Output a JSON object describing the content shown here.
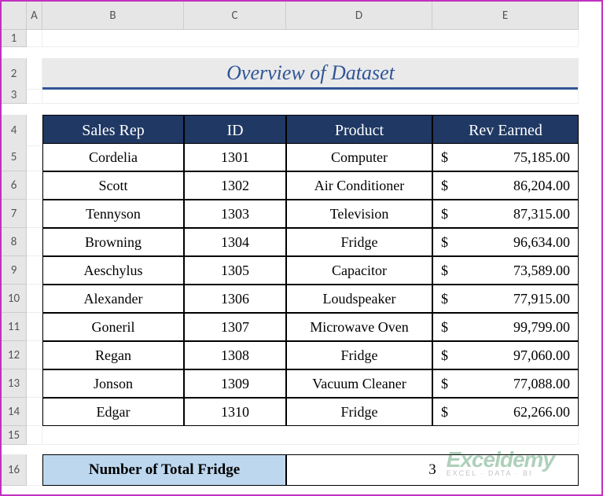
{
  "columns": [
    "",
    "A",
    "B",
    "C",
    "D",
    "E"
  ],
  "row_numbers": [
    "1",
    "2",
    "3",
    "4",
    "5",
    "6",
    "7",
    "8",
    "9",
    "10",
    "11",
    "12",
    "13",
    "14",
    "15",
    "16"
  ],
  "title": "Overview of Dataset",
  "headers": [
    "Sales Rep",
    "ID",
    "Product",
    "Rev Earned"
  ],
  "rows": [
    {
      "rep": "Cordelia",
      "id": "1301",
      "product": "Computer",
      "sym": "$",
      "rev": "75,185.00"
    },
    {
      "rep": "Scott",
      "id": "1302",
      "product": "Air Conditioner",
      "sym": "$",
      "rev": "86,204.00"
    },
    {
      "rep": "Tennyson",
      "id": "1303",
      "product": "Television",
      "sym": "$",
      "rev": "87,315.00"
    },
    {
      "rep": "Browning",
      "id": "1304",
      "product": "Fridge",
      "sym": "$",
      "rev": "96,634.00"
    },
    {
      "rep": "Aeschylus",
      "id": "1305",
      "product": "Capacitor",
      "sym": "$",
      "rev": "73,589.00"
    },
    {
      "rep": "Alexander",
      "id": "1306",
      "product": "Loudspeaker",
      "sym": "$",
      "rev": "77,915.00"
    },
    {
      "rep": "Goneril",
      "id": "1307",
      "product": "Microwave Oven",
      "sym": "$",
      "rev": "99,799.00"
    },
    {
      "rep": "Regan",
      "id": "1308",
      "product": "Fridge",
      "sym": "$",
      "rev": "97,060.00"
    },
    {
      "rep": "Jonson",
      "id": "1309",
      "product": "Vacuum Cleaner",
      "sym": "$",
      "rev": "77,088.00"
    },
    {
      "rep": "Edgar",
      "id": "1310",
      "product": "Fridge",
      "sym": "$",
      "rev": "62,266.00"
    }
  ],
  "summary": {
    "label": "Number of Total Fridge",
    "value": "3"
  },
  "watermark": {
    "main": "Exceldemy",
    "sub": "EXCEL · DATA · BI"
  },
  "chart_data": {
    "type": "table",
    "title": "Overview of Dataset",
    "columns": [
      "Sales Rep",
      "ID",
      "Product",
      "Rev Earned"
    ],
    "data": [
      [
        "Cordelia",
        1301,
        "Computer",
        75185.0
      ],
      [
        "Scott",
        1302,
        "Air Conditioner",
        86204.0
      ],
      [
        "Tennyson",
        1303,
        "Television",
        87315.0
      ],
      [
        "Browning",
        1304,
        "Fridge",
        96634.0
      ],
      [
        "Aeschylus",
        1305,
        "Capacitor",
        73589.0
      ],
      [
        "Alexander",
        1306,
        "Loudspeaker",
        77915.0
      ],
      [
        "Goneril",
        1307,
        "Microwave Oven",
        99799.0
      ],
      [
        "Regan",
        1308,
        "Fridge",
        97060.0
      ],
      [
        "Jonson",
        1309,
        "Vacuum Cleaner",
        77088.0
      ],
      [
        "Edgar",
        1310,
        "Fridge",
        62266.0
      ]
    ],
    "summary": {
      "label": "Number of Total Fridge",
      "value": 3
    }
  }
}
